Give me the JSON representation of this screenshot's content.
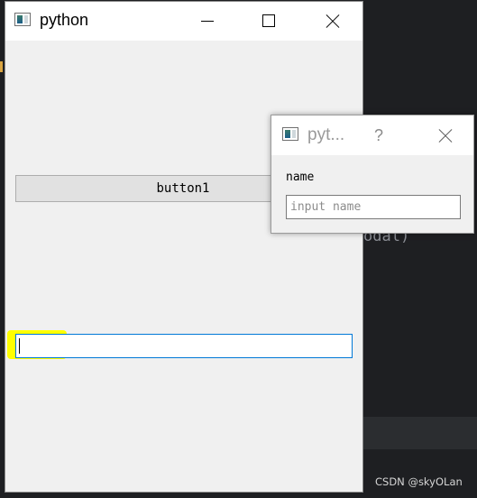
{
  "main_window": {
    "title": "python",
    "button1_label": "button1",
    "line_edit_value": ""
  },
  "dialog": {
    "title": "pyt...",
    "help_symbol": "?",
    "name_label": "name",
    "name_input_value": "",
    "name_input_placeholder": "input name"
  },
  "editor_background": {
    "code_fragment": "odal)"
  },
  "watermark": "CSDN @skyOLan",
  "colors": {
    "highlight": "#ffff00",
    "focus_border": "#0078d7",
    "editor_bg": "#1e1f22"
  }
}
